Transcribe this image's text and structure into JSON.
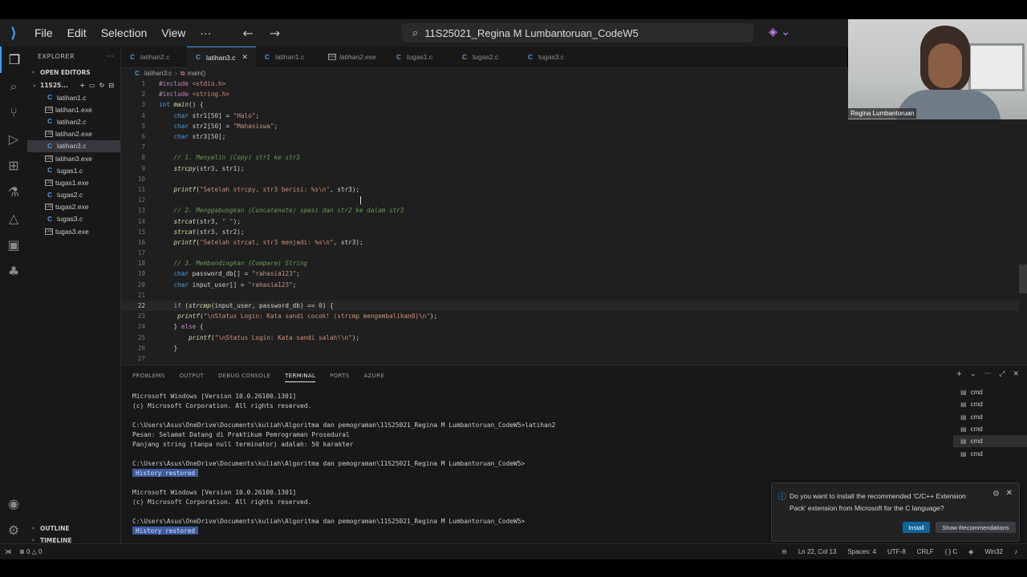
{
  "menu": [
    "File",
    "Edit",
    "Selection",
    "View"
  ],
  "menu_more": "···",
  "nav_back": "←",
  "nav_forward": "→",
  "command_center": "11S25021_Regina M Lumbantoruan_CodeW5",
  "explorer": {
    "title": "EXPLORER",
    "more": "···",
    "open_editors": "OPEN EDITORS",
    "root": "11S25...",
    "files": [
      {
        "name": "latihan1.c",
        "type": "c"
      },
      {
        "name": "latihan1.exe",
        "type": "exe"
      },
      {
        "name": "latihan2.c",
        "type": "c"
      },
      {
        "name": "latihan2.exe",
        "type": "exe"
      },
      {
        "name": "latihan3.c",
        "type": "c"
      },
      {
        "name": "latihan3.exe",
        "type": "exe"
      },
      {
        "name": "tugas1.c",
        "type": "c"
      },
      {
        "name": "tugas1.exe",
        "type": "exe"
      },
      {
        "name": "tugas2.c",
        "type": "c"
      },
      {
        "name": "tugas2.exe",
        "type": "exe"
      },
      {
        "name": "tugas3.c",
        "type": "c"
      },
      {
        "name": "tugas3.exe",
        "type": "exe"
      }
    ],
    "outline": "OUTLINE",
    "timeline": "TIMELINE"
  },
  "tabs": [
    {
      "label": "latihan2.c",
      "type": "c"
    },
    {
      "label": "latihan3.c",
      "type": "c",
      "active": true
    },
    {
      "label": "latihan1.c",
      "type": "c"
    },
    {
      "label": "latihan2.exe",
      "type": "exe"
    },
    {
      "label": "tugas1.c",
      "type": "c"
    },
    {
      "label": "tugas2.c",
      "type": "c"
    },
    {
      "label": "tugas3.c",
      "type": "c"
    }
  ],
  "breadcrumb": {
    "file": "latihan3.c",
    "symbol": "main()"
  },
  "code_lines": [
    "#include <stdio.h>",
    "#include <string.h>",
    "int main() {",
    "    char str1[50] = \"Halo\";",
    "    char str2[50] = \"Mahasiswa\";",
    "    char str3[50];",
    "",
    "    // 1. Menyalin (Copy) str1 ke str3",
    "    strcpy(str3, str1);",
    "",
    "    printf(\"Setelah strcpy, str3 berisi: %s\\n\", str3);",
    "",
    "    // 2. Menggabungkan (Concatenate) spasi dan str2 ke dalam str3",
    "    strcat(str3, \" \");",
    "    strcat(str3, str2);",
    "    printf(\"Setelah strcat, str3 menjadi: %s\\n\", str3);",
    "",
    "    // 3. Membandingkan (Compare) String",
    "    char password_db[] = \"rahasia123\";",
    "    char input_user[] = \"rahasia123\";",
    "",
    "    if (strcmp(input_user, password_db) == 0) {",
    "     printf(\"\\nStatus Login: Kata sandi cocok! (strcmp mengembalikan0)\\n\");",
    "    } else {",
    "        printf(\"\\nStatus Login: Kata sandi salah!\\n\");",
    "    }",
    ""
  ],
  "current_line": 22,
  "panel_tabs": [
    "PROBLEMS",
    "OUTPUT",
    "DEBUG CONSOLE",
    "TERMINAL",
    "PORTS",
    "AZURE"
  ],
  "active_panel_tab": "TERMINAL",
  "terminal": [
    {
      "text": "Microsoft Windows [Version 10.0.26100.1301]"
    },
    {
      "text": "(c) Microsoft Corporation. All rights reserved."
    },
    {
      "text": ""
    },
    {
      "text": "C:\\Users\\Asus\\OneDrive\\Documents\\kuliah\\Algoritma dan pemograman\\11S25021_Regina M Lumbantoruan_CodeW5>latihan2"
    },
    {
      "text": "Pesan: Selamat Datang di Praktikum Pemrograman Prosedural"
    },
    {
      "text": "Panjang string (tanpa null terminator) adalah: 50 karakter"
    },
    {
      "text": ""
    },
    {
      "text": "C:\\Users\\Asus\\OneDrive\\Documents\\kuliah\\Algoritma dan pemograman\\11S25021_Regina M Lumbantoruan_CodeW5>"
    },
    {
      "text": "History restored",
      "badge": true
    },
    {
      "text": ""
    },
    {
      "text": "Microsoft Windows [Version 10.0.26100.1301]"
    },
    {
      "text": "(c) Microsoft Corporation. All rights reserved."
    },
    {
      "text": ""
    },
    {
      "text": "C:\\Users\\Asus\\OneDrive\\Documents\\kuliah\\Algoritma dan pemograman\\11S25021_Regina M Lumbantoruan_CodeW5>"
    },
    {
      "text": "History restored",
      "badge": true
    }
  ],
  "terminal_list": [
    "cmd",
    "cmd",
    "cmd",
    "cmd",
    "cmd",
    "cmd"
  ],
  "active_terminal_index": 4,
  "notification": {
    "message": "Do you want to install the recommended 'C/C++ Extension Pack' extension from Microsoft for the C language?",
    "install": "Install",
    "show": "Show Recommendations"
  },
  "status": {
    "errors": "0",
    "warnings": "0",
    "position": "Ln 22, Col 13",
    "spaces": "Spaces: 4",
    "encoding": "UTF-8",
    "eol": "CRLF",
    "language": "{ } C",
    "platform": "Win32"
  },
  "video": {
    "name": "Regina Lumbantoruan"
  },
  "colors": {
    "accent": "#3c9df3",
    "editor_bg": "#1f1f1f",
    "sidebar_bg": "#181818",
    "button": "#0e639c"
  }
}
